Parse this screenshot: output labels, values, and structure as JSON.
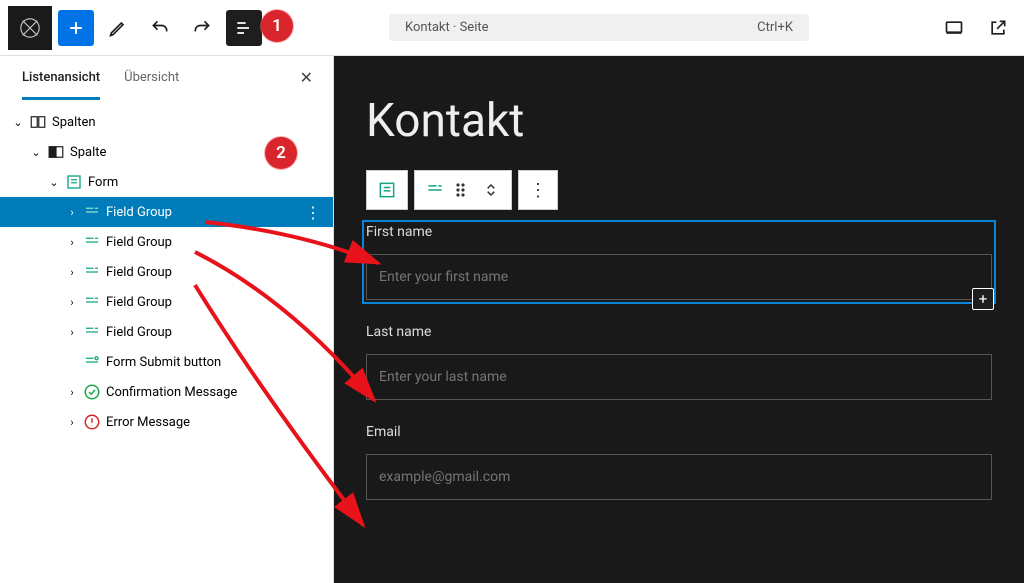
{
  "topbar": {
    "doc_title": "Kontakt · Seite",
    "shortcut": "Ctrl+K"
  },
  "sidebar": {
    "tabs": {
      "list_view": "Listenansicht",
      "overview": "Übersicht"
    },
    "tree": {
      "columns": "Spalten",
      "column": "Spalte",
      "form": "Form",
      "field_group": "Field Group",
      "submit": "Form Submit button",
      "confirm": "Confirmation Message",
      "error": "Error Message"
    }
  },
  "callouts": {
    "one": "1",
    "two": "2"
  },
  "canvas": {
    "heading": "Kontakt",
    "fields": [
      {
        "label": "First name",
        "placeholder": "Enter your first name"
      },
      {
        "label": "Last name",
        "placeholder": "Enter your last name"
      },
      {
        "label": "Email",
        "placeholder": "example@gmail.com"
      }
    ]
  },
  "colors": {
    "accent": "#007cba",
    "danger": "#d9262d",
    "canvas_bg": "#191919"
  }
}
